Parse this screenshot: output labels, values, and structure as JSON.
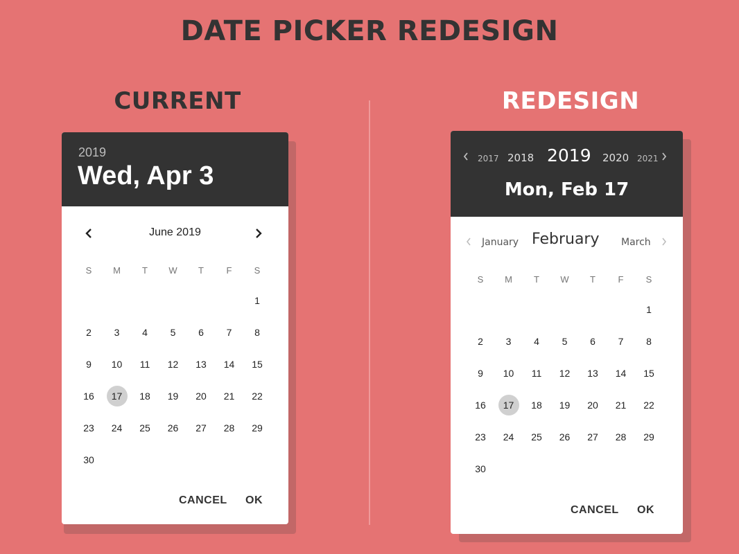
{
  "page": {
    "title": "DATE PICKER REDESIGN",
    "colors": {
      "background": "#e57373",
      "header": "#333333",
      "selected": "#d0d0d0"
    }
  },
  "current": {
    "section_title": "CURRENT",
    "header": {
      "year": "2019",
      "date": "Wed, Apr 3"
    },
    "nav": {
      "month_label": "June 2019",
      "prev_icon": "chevron-left-icon",
      "next_icon": "chevron-right-icon"
    },
    "weekdays": [
      "S",
      "M",
      "T",
      "W",
      "T",
      "F",
      "S"
    ],
    "weeks": [
      [
        "",
        "",
        "",
        "",
        "",
        "",
        "1"
      ],
      [
        "2",
        "3",
        "4",
        "5",
        "6",
        "7",
        "8"
      ],
      [
        "9",
        "10",
        "11",
        "12",
        "13",
        "14",
        "15"
      ],
      [
        "16",
        "17",
        "18",
        "19",
        "20",
        "21",
        "22"
      ],
      [
        "23",
        "24",
        "25",
        "26",
        "27",
        "28",
        "29"
      ],
      [
        "30",
        "",
        "",
        "",
        "",
        "",
        ""
      ]
    ],
    "selected_day": "17",
    "actions": {
      "cancel": "CANCEL",
      "ok": "OK"
    }
  },
  "redesign": {
    "section_title": "REDESIGN",
    "header": {
      "years": [
        "2017",
        "2018",
        "2019",
        "2020",
        "2021"
      ],
      "selected_year": "2019",
      "date": "Mon, Feb 17"
    },
    "months": {
      "prev": "January",
      "current": "February",
      "next": "March"
    },
    "weekdays": [
      "S",
      "M",
      "T",
      "W",
      "T",
      "F",
      "S"
    ],
    "weeks": [
      [
        "",
        "",
        "",
        "",
        "",
        "",
        "1"
      ],
      [
        "2",
        "3",
        "4",
        "5",
        "6",
        "7",
        "8"
      ],
      [
        "9",
        "10",
        "11",
        "12",
        "13",
        "14",
        "15"
      ],
      [
        "16",
        "17",
        "18",
        "19",
        "20",
        "21",
        "22"
      ],
      [
        "23",
        "24",
        "25",
        "26",
        "27",
        "28",
        "29"
      ],
      [
        "30",
        "",
        "",
        "",
        "",
        "",
        ""
      ]
    ],
    "selected_day": "17",
    "actions": {
      "cancel": "CANCEL",
      "ok": "OK"
    }
  }
}
